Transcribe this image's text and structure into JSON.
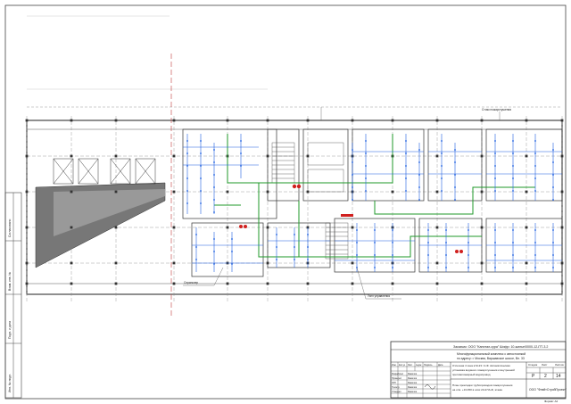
{
  "title_block": {
    "header_line": "Заказчик: ООО \"Капитал-сура\"   Шифр: 10-жилье/0000-12-ПТ-3.2",
    "project_lines": [
      "Многофункциональный комплекс с автостоянкой",
      "по адресу: г. Москва, Варшавское шоссе, Вл. 33"
    ],
    "sheet_name_lines": [
      "Отсечная 4 зона в М-23 / 4-Ф. Автоматическая",
      "установка водяного пожаротушения и внутренний",
      "противопожарный водопровод"
    ],
    "plan_title_lines": [
      "План прокладки трубопроводов пожаротушения",
      "на отм. +13.450 в осях 23-27/А-Ф, этажа"
    ],
    "stage": "Р",
    "sheet": "2",
    "sheets": "14",
    "stage_label": "Стадия",
    "sheet_label": "Лист",
    "sheets_label": "Листов",
    "company": "ООО \"ФлайтСтройПроект\"",
    "format": "Формат А2",
    "rev_headers": [
      "Изм.",
      "Кол.уч",
      "Лист",
      "№док",
      "Подпись",
      "Дата"
    ],
    "roles": [
      "Разработал",
      "Проверил",
      "ГИП",
      "Н.контр.",
      "Утвердил"
    ],
    "role_names": [
      "Фамилия",
      "Фамилия",
      "Фамилия",
      "Фамилия",
      "Фамилия"
    ]
  },
  "side_stamp": {
    "labels": [
      "Инв. № подл.",
      "Подп. и дата",
      "Взам. инв. №",
      "Согласовано"
    ]
  },
  "callouts": [
    "Узел управления",
    "Спринклер",
    "Стояк пожаротушения"
  ],
  "colors": {
    "line": "#333333",
    "sprinkler_pipe": "#1e5fe0",
    "main_pipe": "#1f9a2a",
    "marker": "#d0201f",
    "axis_marker": "#c23b3b"
  }
}
